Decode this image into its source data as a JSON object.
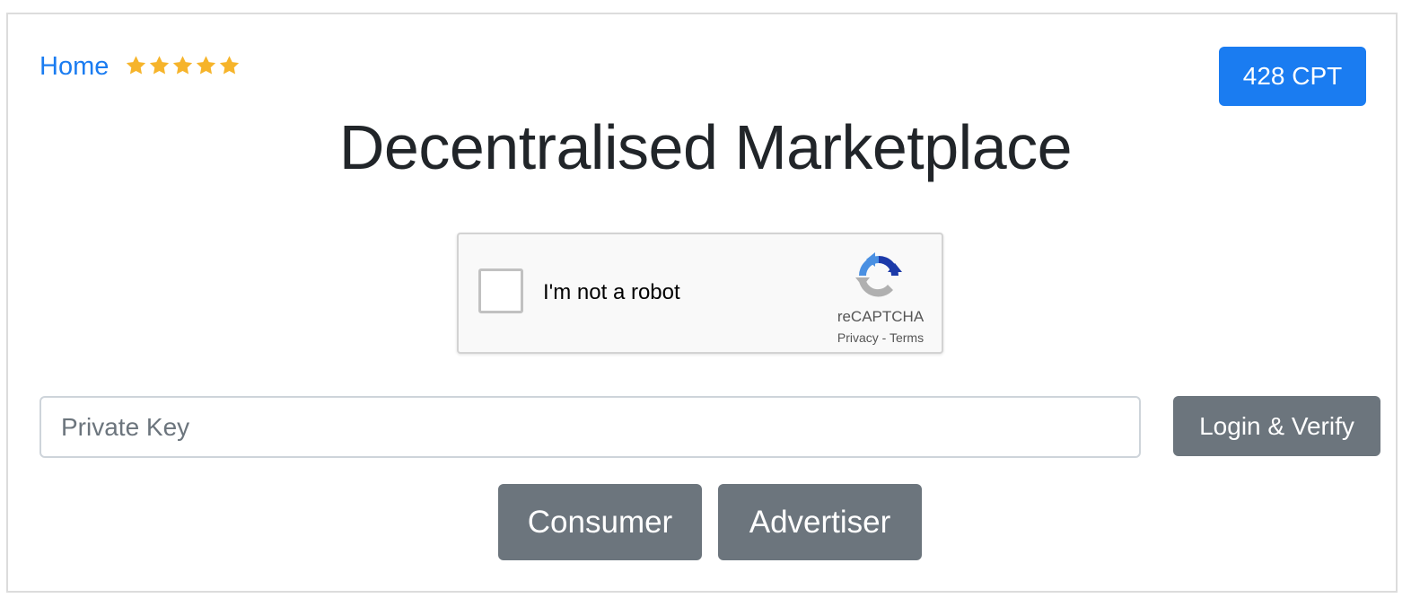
{
  "nav": {
    "home_label": "Home",
    "rating": {
      "value": 5,
      "max": 5,
      "color": "#f6b42b",
      "icon": "star-icon"
    }
  },
  "balance": {
    "label": "428 CPT",
    "color": "#1a7cf1"
  },
  "title": "Decentralised Marketplace",
  "recaptcha": {
    "checkbox_label": "I'm not a robot",
    "checked": false,
    "brand": "reCAPTCHA",
    "privacy_label": "Privacy",
    "separator": " - ",
    "terms_label": "Terms",
    "icon": "recaptcha-logo-icon"
  },
  "login": {
    "private_key_placeholder": "Private Key",
    "private_key_value": "",
    "submit_label": "Login & Verify"
  },
  "roles": {
    "consumer_label": "Consumer",
    "advertiser_label": "Advertiser",
    "button_color": "#6c757d"
  }
}
